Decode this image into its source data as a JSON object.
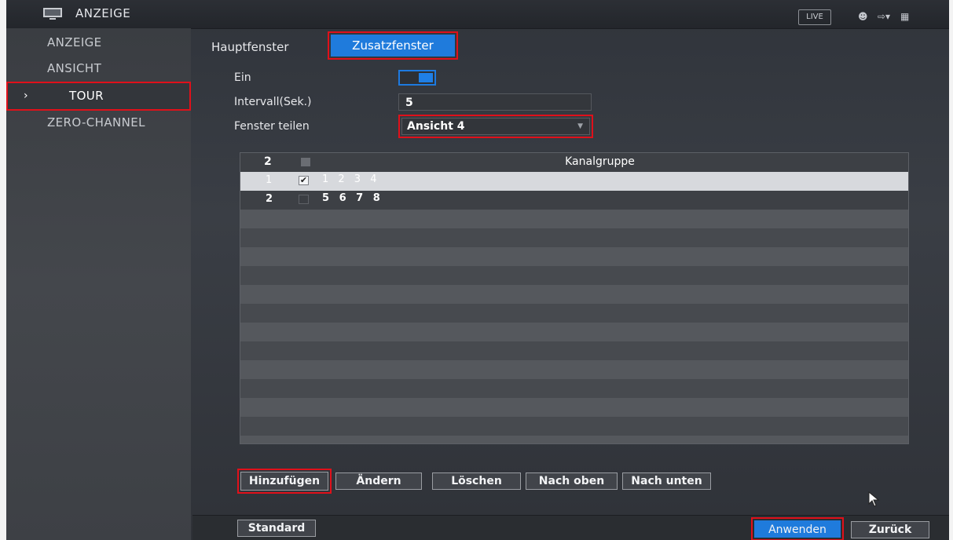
{
  "header": {
    "app_title": "ANZEIGE",
    "live_label": "LIVE",
    "icons": [
      "monitor-icon",
      "user-icon",
      "logout-icon",
      "grid-icon"
    ]
  },
  "sidebar": {
    "items": [
      {
        "label": "ANZEIGE"
      },
      {
        "label": "ANSICHT"
      },
      {
        "label": "TOUR",
        "active": true
      },
      {
        "label": "ZERO-CHANNEL"
      }
    ]
  },
  "tabs": [
    {
      "label": "Hauptfenster"
    },
    {
      "label": "Zusatzfenster",
      "active": true
    }
  ],
  "form": {
    "enable_label": "Ein",
    "enable_value": true,
    "interval_label": "Intervall(Sek.)",
    "interval_value": "5",
    "split_label": "Fenster teilen",
    "split_value": "Ansicht 4"
  },
  "table": {
    "header_count": "2",
    "header_title": "Kanalgruppe",
    "rows": [
      {
        "num": "1",
        "checked": true,
        "channels": "1 2 3 4"
      },
      {
        "num": "2",
        "checked": false,
        "channels": "5 6 7 8"
      }
    ]
  },
  "actions": {
    "add": "Hinzufügen",
    "edit": "Ändern",
    "delete": "Löschen",
    "move_up": "Nach oben",
    "move_down": "Nach unten"
  },
  "footer": {
    "default": "Standard",
    "apply": "Anwenden",
    "back": "Zurück"
  },
  "colors": {
    "accent": "#1f7bdc",
    "highlight": "#e0101a"
  }
}
